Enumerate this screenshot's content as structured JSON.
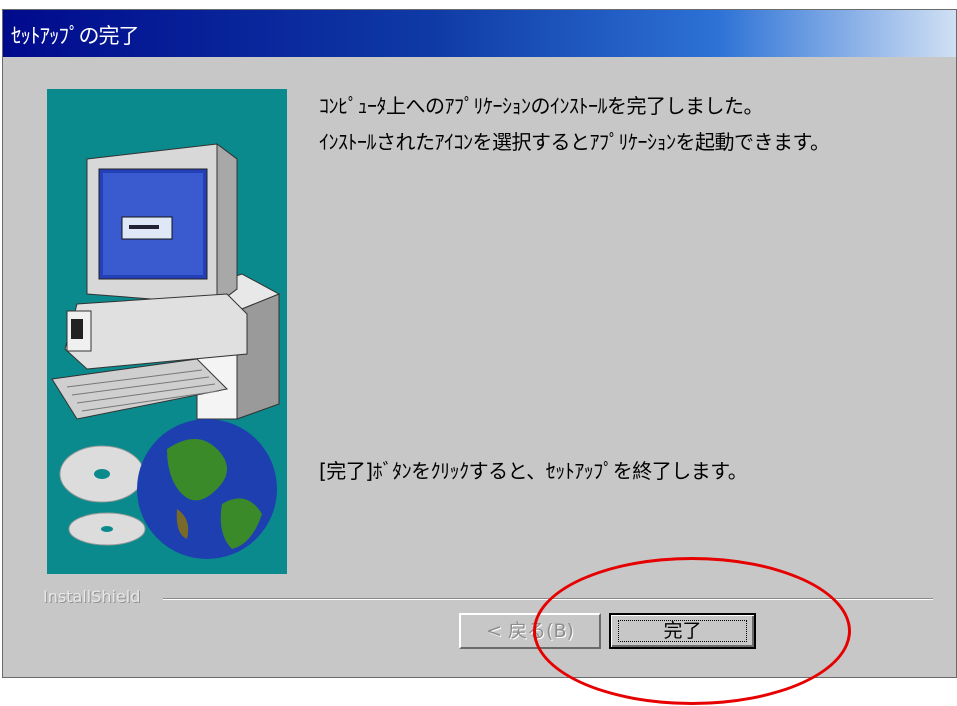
{
  "window": {
    "title": "ｾｯﾄｱｯﾌﾟの完了"
  },
  "messages": {
    "line1": "ｺﾝﾋﾟｭｰﾀ上へのｱﾌﾟﾘｹｰｼｮﾝのｲﾝｽﾄｰﾙを完了しました。",
    "line2": " ｲﾝｽﾄｰﾙされたｱｲｺﾝを選択するとｱﾌﾟﾘｹｰｼｮﾝを起動できます。",
    "line3": "[完了]ﾎﾞﾀﾝをｸﾘｯｸすると、ｾｯﾄｱｯﾌﾟを終了します。"
  },
  "footer": {
    "brand": "InstallShield",
    "back_label": "< 戻る(B)",
    "finish_label": "完了"
  },
  "colors": {
    "title_bar_start": "#000a8c",
    "art_background": "#0a8a8c",
    "highlight": "#e60000"
  }
}
